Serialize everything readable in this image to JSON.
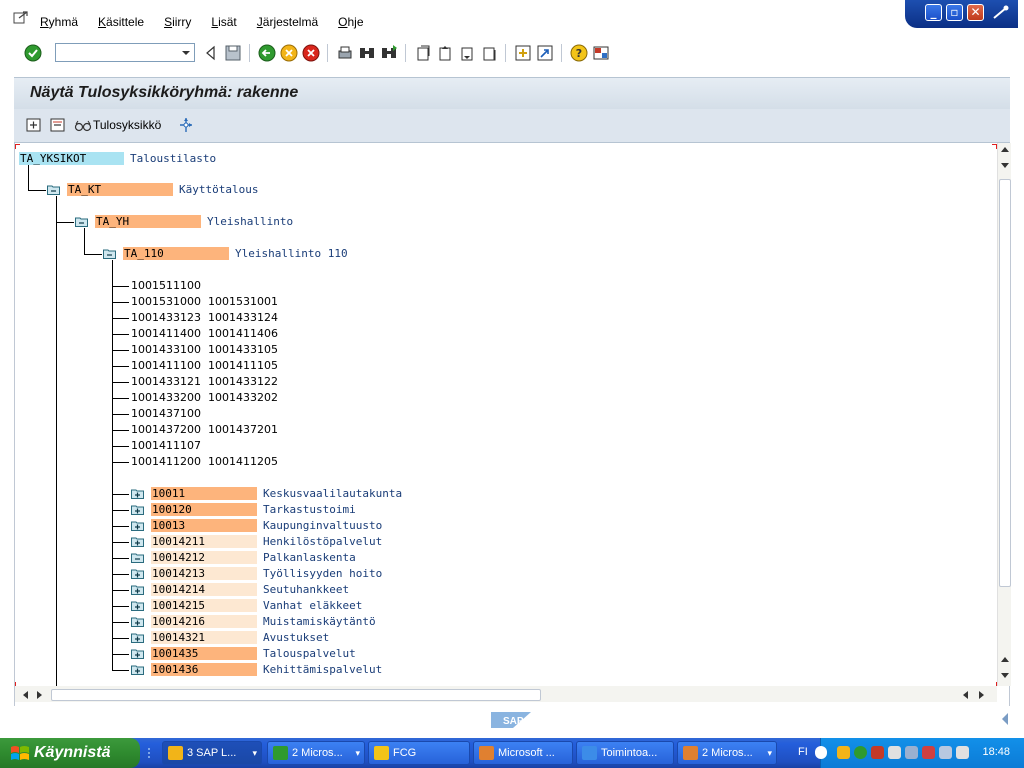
{
  "menu": {
    "items": [
      "Ryhmä",
      "Käsittele",
      "Siirry",
      "Lisät",
      "Järjestelmä",
      "Ohje"
    ]
  },
  "page": {
    "title": "Näytä Tulosyksikköryhmä: rakenne"
  },
  "app_toolbar": {
    "tulosyksikko_label": "Tulosyksikkö"
  },
  "tree": {
    "root": {
      "code": "TA_YKSIKOT",
      "text": "Taloustilasto"
    },
    "level1": {
      "code": "TA_KT",
      "text": "Käyttötalous"
    },
    "level2": {
      "code": "TA_YH",
      "text": "Yleishallinto"
    },
    "level3": {
      "code": "TA_110",
      "text": "Yleishallinto 110"
    },
    "leaves": [
      {
        "a": "1001511100",
        "b": ""
      },
      {
        "a": "1001531000",
        "b": "1001531001"
      },
      {
        "a": "1001433123",
        "b": "1001433124"
      },
      {
        "a": "1001411400",
        "b": "1001411406"
      },
      {
        "a": "1001433100",
        "b": "1001433105"
      },
      {
        "a": "1001411100",
        "b": "1001411105"
      },
      {
        "a": "1001433121",
        "b": "1001433122"
      },
      {
        "a": "1001433200",
        "b": "1001433202"
      },
      {
        "a": "1001437100",
        "b": ""
      },
      {
        "a": "1001437200",
        "b": "1001437201"
      },
      {
        "a": "1001411107",
        "b": ""
      },
      {
        "a": "1001411200",
        "b": "1001411205"
      }
    ],
    "groups": [
      {
        "code": "10011",
        "text": "Keskusvaalilautakunta",
        "strong": true,
        "expanded": false
      },
      {
        "code": "100120",
        "text": "Tarkastustoimi",
        "strong": true,
        "expanded": false
      },
      {
        "code": "10013",
        "text": "Kaupunginvaltuusto",
        "strong": true,
        "expanded": false
      },
      {
        "code": "10014211",
        "text": "Henkilöstöpalvelut",
        "strong": false,
        "expanded": false
      },
      {
        "code": "10014212",
        "text": "Palkanlaskenta",
        "strong": false,
        "expanded": true
      },
      {
        "code": "10014213",
        "text": "Työllisyyden hoito",
        "strong": false,
        "expanded": false
      },
      {
        "code": "10014214",
        "text": "Seutuhankkeet",
        "strong": false,
        "expanded": false
      },
      {
        "code": "10014215",
        "text": "Vanhat eläkkeet",
        "strong": false,
        "expanded": false
      },
      {
        "code": "10014216",
        "text": "Muistamiskäytäntö",
        "strong": false,
        "expanded": false
      },
      {
        "code": "10014321",
        "text": "Avustukset",
        "strong": false,
        "expanded": false
      },
      {
        "code": "1001435",
        "text": "Talouspalvelut",
        "strong": true,
        "expanded": false
      },
      {
        "code": "1001436",
        "text": "Kehittämispalvelut",
        "strong": true,
        "expanded": false
      }
    ]
  },
  "colors": {
    "root_bg": "#a9e3f2",
    "node_strong": "#fdb47c",
    "node_light": "#fde8d2"
  },
  "taskbar": {
    "start_label": "Käynnistä",
    "tasks": [
      {
        "label": "3 SAP L...",
        "icon": "sap-folder-icon",
        "caret": "▾"
      },
      {
        "label": "2 Micros...",
        "icon": "excel-icon",
        "caret": "▾"
      },
      {
        "label": "FCG",
        "icon": "folder-icon",
        "caret": ""
      },
      {
        "label": "Microsoft ...",
        "icon": "outlook-icon",
        "caret": ""
      },
      {
        "label": "Toimintoa...",
        "icon": "ie-icon",
        "caret": ""
      },
      {
        "label": "2 Micros...",
        "icon": "outlook-icon",
        "caret": "▾"
      }
    ],
    "language": "FI",
    "clock": "18:48"
  }
}
